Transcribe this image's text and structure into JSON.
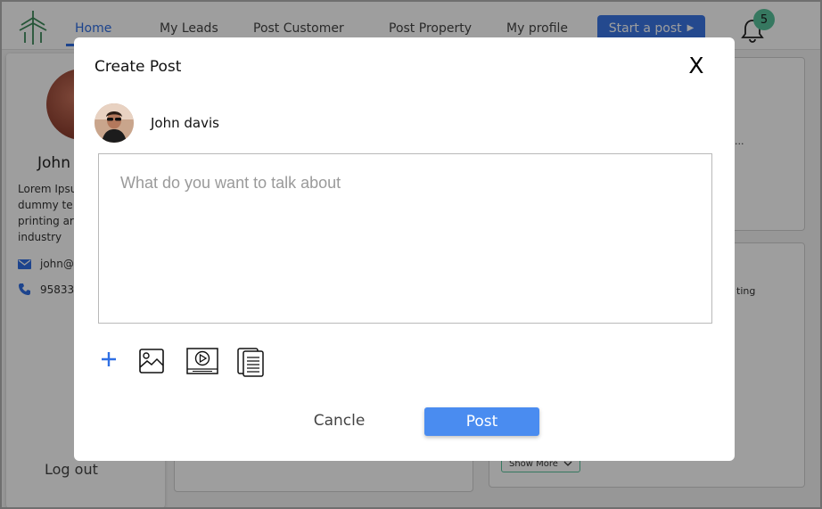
{
  "nav": {
    "items": [
      {
        "label": "Home",
        "active": true
      },
      {
        "label": "My Leads"
      },
      {
        "label": "Post  Customer"
      },
      {
        "label": "Post Property"
      },
      {
        "label": "My profile"
      }
    ],
    "start_post_label": "Start a post",
    "notification_count": "5"
  },
  "profile": {
    "name_visible": "John",
    "bio_lines": [
      "Lorem Ipsu",
      "dummy te",
      "printing ar",
      "industry"
    ],
    "email_visible": "john@",
    "phone_visible": "95833"
  },
  "sidebar": {
    "logout_label": "Log out"
  },
  "feed": {
    "right_snippet": "ting",
    "right_ellipsis": "...",
    "show_more_label": "Show More"
  },
  "modal": {
    "title": "Create Post",
    "close_label": "X",
    "author_name": "John davis",
    "input_placeholder": "What do you want to talk about",
    "cancel_label": "Cancle",
    "post_label": "Post",
    "tools": [
      "add-icon",
      "image-icon",
      "video-icon",
      "document-icon"
    ]
  },
  "colors": {
    "accent": "#3a77e6",
    "post_button": "#4a8cf0",
    "badge": "#58c29c",
    "overlay": "rgba(0,0,0,0.38)"
  }
}
